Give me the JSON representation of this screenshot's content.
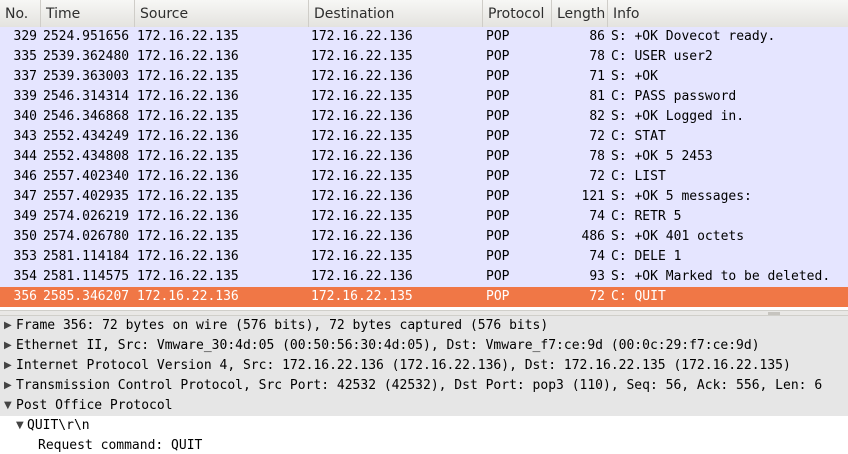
{
  "columns": {
    "no": "No.",
    "time": "Time",
    "source": "Source",
    "destination": "Destination",
    "protocol": "Protocol",
    "length": "Length",
    "info": "Info"
  },
  "packets": [
    {
      "no": "329",
      "time": "2524.951656",
      "src": "172.16.22.135",
      "dst": "172.16.22.136",
      "proto": "POP",
      "len": "86",
      "info": "S: +OK Dovecot ready."
    },
    {
      "no": "335",
      "time": "2539.362480",
      "src": "172.16.22.136",
      "dst": "172.16.22.135",
      "proto": "POP",
      "len": "78",
      "info": "C: USER user2"
    },
    {
      "no": "337",
      "time": "2539.363003",
      "src": "172.16.22.135",
      "dst": "172.16.22.136",
      "proto": "POP",
      "len": "71",
      "info": "S: +OK"
    },
    {
      "no": "339",
      "time": "2546.314314",
      "src": "172.16.22.136",
      "dst": "172.16.22.135",
      "proto": "POP",
      "len": "81",
      "info": "C: PASS password"
    },
    {
      "no": "340",
      "time": "2546.346868",
      "src": "172.16.22.135",
      "dst": "172.16.22.136",
      "proto": "POP",
      "len": "82",
      "info": "S: +OK Logged in."
    },
    {
      "no": "343",
      "time": "2552.434249",
      "src": "172.16.22.136",
      "dst": "172.16.22.135",
      "proto": "POP",
      "len": "72",
      "info": "C: STAT"
    },
    {
      "no": "344",
      "time": "2552.434808",
      "src": "172.16.22.135",
      "dst": "172.16.22.136",
      "proto": "POP",
      "len": "78",
      "info": "S: +OK 5 2453"
    },
    {
      "no": "346",
      "time": "2557.402340",
      "src": "172.16.22.136",
      "dst": "172.16.22.135",
      "proto": "POP",
      "len": "72",
      "info": "C: LIST"
    },
    {
      "no": "347",
      "time": "2557.402935",
      "src": "172.16.22.135",
      "dst": "172.16.22.136",
      "proto": "POP",
      "len": "121",
      "info": "S: +OK 5 messages:"
    },
    {
      "no": "349",
      "time": "2574.026219",
      "src": "172.16.22.136",
      "dst": "172.16.22.135",
      "proto": "POP",
      "len": "74",
      "info": "C: RETR 5"
    },
    {
      "no": "350",
      "time": "2574.026780",
      "src": "172.16.22.135",
      "dst": "172.16.22.136",
      "proto": "POP",
      "len": "486",
      "info": "S: +OK 401 octets"
    },
    {
      "no": "353",
      "time": "2581.114184",
      "src": "172.16.22.136",
      "dst": "172.16.22.135",
      "proto": "POP",
      "len": "74",
      "info": "C: DELE 1"
    },
    {
      "no": "354",
      "time": "2581.114575",
      "src": "172.16.22.135",
      "dst": "172.16.22.136",
      "proto": "POP",
      "len": "93",
      "info": "S: +OK Marked to be deleted."
    },
    {
      "no": "356",
      "time": "2585.346207",
      "src": "172.16.22.136",
      "dst": "172.16.22.135",
      "proto": "POP",
      "len": "72",
      "info": "C: QUIT",
      "selected": true
    }
  ],
  "details": [
    {
      "text": "Frame 356: 72 bytes on wire (576 bits), 72 bytes captured (576 bits)",
      "expander": "collapsed",
      "indent": 0
    },
    {
      "text": "Ethernet II, Src: Vmware_30:4d:05 (00:50:56:30:4d:05), Dst: Vmware_f7:ce:9d (00:0c:29:f7:ce:9d)",
      "expander": "collapsed",
      "indent": 0
    },
    {
      "text": "Internet Protocol Version 4, Src: 172.16.22.136 (172.16.22.136), Dst: 172.16.22.135 (172.16.22.135)",
      "expander": "collapsed",
      "indent": 0
    },
    {
      "text": "Transmission Control Protocol, Src Port: 42532 (42532), Dst Port: pop3 (110), Seq: 56, Ack: 556, Len: 6",
      "expander": "collapsed",
      "indent": 0
    },
    {
      "text": "Post Office Protocol",
      "expander": "expanded",
      "indent": 0
    },
    {
      "text": "QUIT\\r\\n",
      "expander": "expanded",
      "indent": 1
    },
    {
      "text": "Request command: QUIT",
      "expander": "none",
      "indent": 2
    }
  ],
  "colors": {
    "row_bg": "#e5e5ff",
    "selected_bg": "#f07746",
    "detail_bg": "#e6e6e6"
  }
}
